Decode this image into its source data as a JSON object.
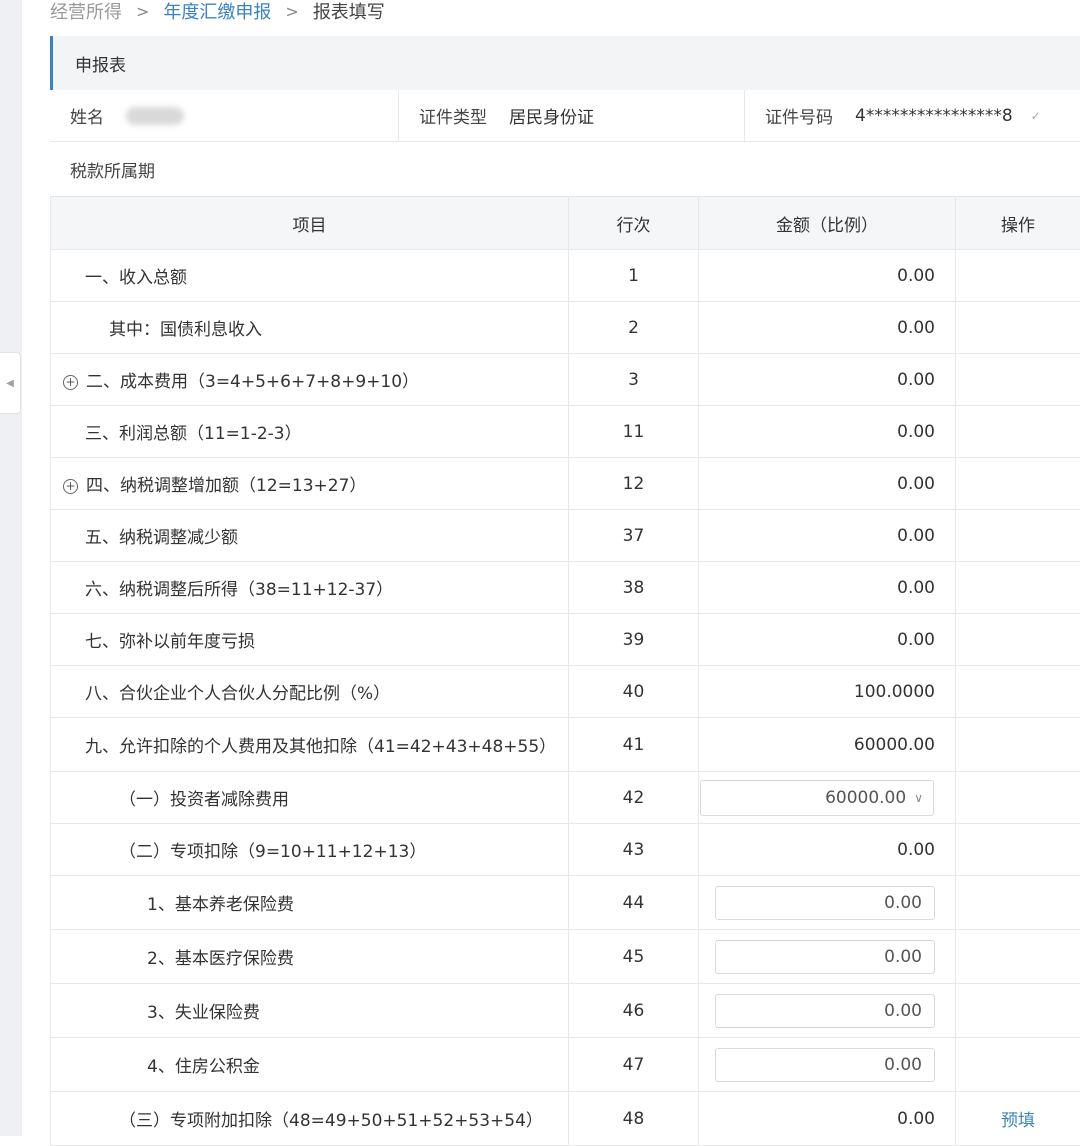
{
  "breadcrumb": {
    "items": [
      "经营所得",
      "年度汇缴申报",
      "报表填写"
    ],
    "separator": ">"
  },
  "form": {
    "title": "申报表",
    "name_label": "姓名",
    "id_type_label": "证件类型",
    "id_type_value": "居民身份证",
    "id_number_label": "证件号码",
    "id_number_value": "4****************8",
    "period_label": "税款所属期"
  },
  "table": {
    "headers": {
      "item": "项目",
      "line": "行次",
      "amount": "金额（比例）",
      "action": "操作"
    },
    "rows": [
      {
        "item": "一、收入总额",
        "line": "1",
        "amount": "0.00"
      },
      {
        "item": "其中：国债利息收入",
        "line": "2",
        "amount": "0.00"
      },
      {
        "item": "二、成本费用（3=4+5+6+7+8+9+10）",
        "line": "3",
        "amount": "0.00"
      },
      {
        "item": "三、利润总额（11=1-2-3）",
        "line": "11",
        "amount": "0.00"
      },
      {
        "item": "四、纳税调整增加额（12=13+27）",
        "line": "12",
        "amount": "0.00"
      },
      {
        "item": "五、纳税调整减少额",
        "line": "37",
        "amount": "0.00"
      },
      {
        "item": "六、纳税调整后所得（38=11+12-37）",
        "line": "38",
        "amount": "0.00"
      },
      {
        "item": "七、弥补以前年度亏损",
        "line": "39",
        "amount": "0.00"
      },
      {
        "item": "八、合伙企业个人合伙人分配比例（%）",
        "line": "40",
        "amount": "100.0000"
      },
      {
        "item": "九、允许扣除的个人费用及其他扣除（41=42+43+48+55）",
        "line": "41",
        "amount": "60000.00"
      },
      {
        "item": "（一）投资者减除费用",
        "line": "42",
        "amount": "60000.00"
      },
      {
        "item": "（二）专项扣除（9=10+11+12+13）",
        "line": "43",
        "amount": "0.00"
      },
      {
        "item": "1、基本养老保险费",
        "line": "44",
        "amount": "0.00"
      },
      {
        "item": "2、基本医疗保险费",
        "line": "45",
        "amount": "0.00"
      },
      {
        "item": "3、失业保险费",
        "line": "46",
        "amount": "0.00"
      },
      {
        "item": "4、住房公积金",
        "line": "47",
        "amount": "0.00"
      },
      {
        "item": "（三）专项附加扣除（48=49+50+51+52+53+54）",
        "line": "48",
        "amount": "0.00",
        "action": "预填"
      }
    ]
  },
  "icons": {
    "expand": "plus-circle-icon",
    "collapse_panel": "caret-left-icon",
    "dropdown": "chevron-down-icon",
    "breadcrumb_separator": "chevron-right-icon"
  },
  "colors": {
    "accent": "#3b82c4",
    "header_bg": "#f3f4f6",
    "border": "#e8e8e8"
  }
}
